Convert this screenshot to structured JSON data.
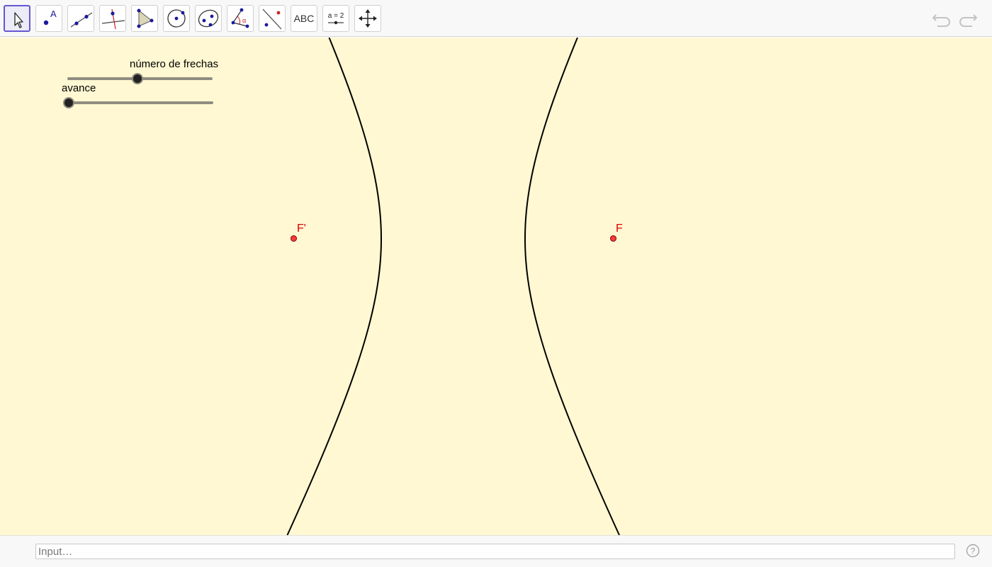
{
  "toolbar": {
    "tools": [
      {
        "name": "move-tool",
        "icon": "arrow-cursor-icon",
        "selected": true
      },
      {
        "name": "point-tool",
        "icon": "point-icon",
        "label": "A"
      },
      {
        "name": "line-tool",
        "icon": "line-icon"
      },
      {
        "name": "perpendicular-line-tool",
        "icon": "perpendicular-icon"
      },
      {
        "name": "polygon-tool",
        "icon": "polygon-icon"
      },
      {
        "name": "circle-tool",
        "icon": "circle-center-point-icon"
      },
      {
        "name": "conic-tool",
        "icon": "ellipse-icon"
      },
      {
        "name": "angle-tool",
        "icon": "angle-icon",
        "label": "α"
      },
      {
        "name": "reflect-tool",
        "icon": "reflect-icon"
      },
      {
        "name": "text-tool",
        "icon": "text-icon",
        "label": "ABC"
      },
      {
        "name": "slider-tool",
        "icon": "slider-icon",
        "label": "a = 2"
      },
      {
        "name": "move-graphics-view-tool",
        "icon": "move-view-icon"
      }
    ],
    "undo_icon": "undo-icon",
    "redo_icon": "redo-icon"
  },
  "sliders": {
    "frechas": {
      "label": "número de frechas",
      "fraction": 0.485
    },
    "avance": {
      "label": "avance",
      "fraction": 0.0
    }
  },
  "points": {
    "f_prime": {
      "label": "F'"
    },
    "f": {
      "label": "F"
    }
  },
  "input": {
    "placeholder": "Input…",
    "value": ""
  },
  "help_icon": "help-icon",
  "colors": {
    "canvas_bg": "#fff8d2",
    "point_fill": "#ff3a3a",
    "point_label": "#e00000",
    "curve": "#000000",
    "selected_tool_border": "#6557d2"
  }
}
